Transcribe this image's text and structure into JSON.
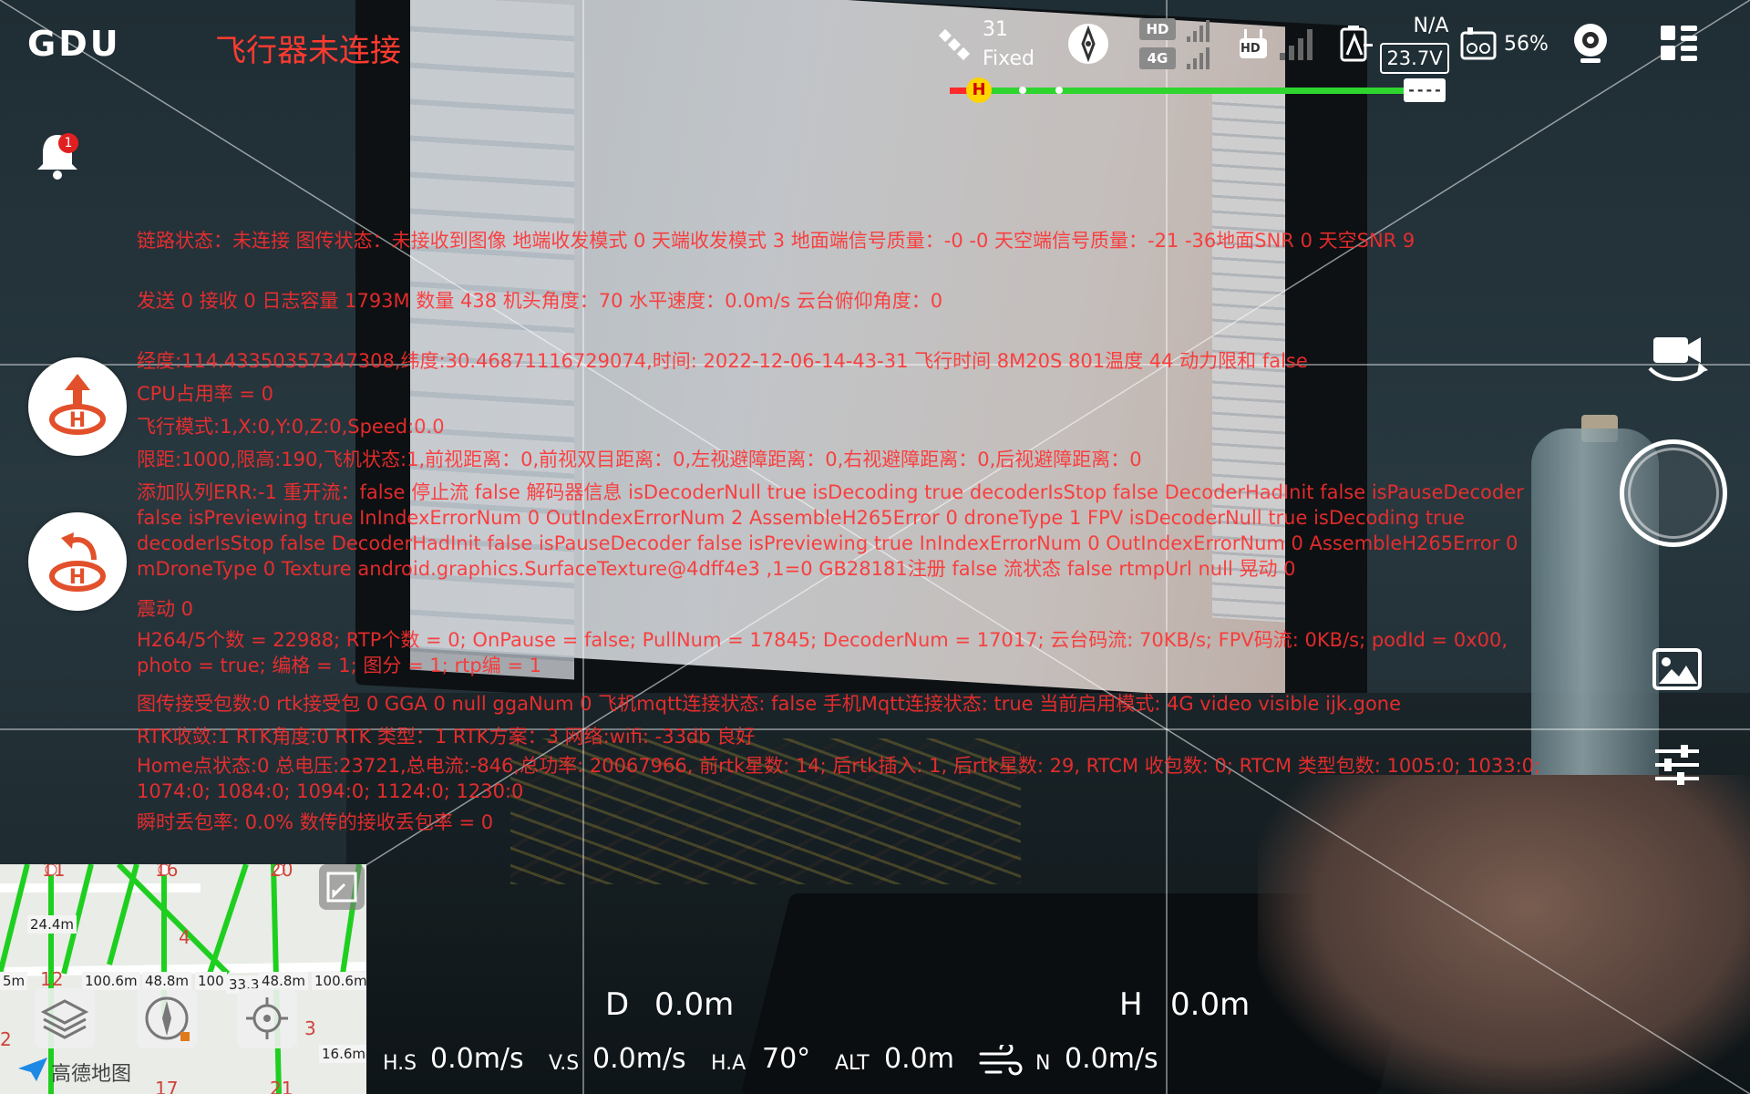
{
  "app": {
    "logo": "GDU",
    "connection_status": "飞行器未连接",
    "notification_count": "1"
  },
  "status_bar": {
    "satellite_count": "31",
    "satellite_fix": "Fixed",
    "hd_badge": "HD",
    "net_badge": "4G",
    "rc_hd_badge": "HD",
    "rc_status": "N/A",
    "voltage": "23.7V",
    "battery_percent": "56%",
    "home_marker": "H",
    "limit_box": "----"
  },
  "debug_lines": [
    " 链路状态：未连接  图传状态：未接收到图像 地端收发模式 0 天端收发模式 3  地面端信号质量：-0 -0  天空端信号质量：-21 -36地面SNR 0 天空SNR 9",
    "       发送 0 接收 0    日志容量 1793M 数量 438 机头角度：70 水平速度：0.0m/s 云台俯仰角度：0",
    "经度:114.43350357347308,纬度:30.46871116729074,时间: 2022-12-06-14-43-31  飞行时间 8M20S  801温度 44 动力限和 false",
    " CPU占用率 = 0",
    "飞行模式:1,X:0,Y:0,Z:0,Speed:0.0",
    "限距:1000,限高:190,飞机状态:1,前视距离：0,前视双目距离：0,左视避障距离：0,右视避障距离：0,后视避障距离：0",
    "添加队列ERR:-1 重开流：false 停止流 false 解码器信息  isDecoderNull true isDecoding true decoderIsStop false DecoderHadInit false isPauseDecoder false isPreviewing true InIndexErrorNum 0 OutIndexErrorNum 2 AssembleH265Error 0 droneType 1 FPV isDecoderNull true isDecoding true decoderIsStop false DecoderHadInit false isPauseDecoder false isPreviewing true InIndexErrorNum 0 OutIndexErrorNum 0 AssembleH265Error 0 mDroneType 0 Texture android.graphics.SurfaceTexture@4dff4e3 ,1=0 GB28181注册 false 流状态 false rtmpUrl null 晃动 0",
    "震动 0",
    " H264/5个数 = 22988; RTP个数 = 0; OnPause = false; PullNum = 17845; DecoderNum = 17017; 云台码流: 70KB/s; FPV码流: 0KB/s; podId = 0x00, photo = true; 编格 = 1; 图分 = 1; rtp编 = 1",
    "图传接受包数:0  rtk接受包 0 GGA 0 null   ggaNum  0    飞机mqtt连接状态: false 手机Mqtt连接状态: true 当前启用模式: 4G  video  visible ijk.gone",
    "RTK收敛:1 RTK角度:0 RTK 类型：1  RTK方案：3  网络:wifi: -33db 良好",
    "Home点状态:0  总电压:23721,总电流:-846,总功率: 20067966, 前rtk星数: 14; 后rtk插入: 1, 后rtk星数: 29, RTCM 收包数: 0; RTCM 类型包数: 1005:0; 1033:0; 1074:0; 1084:0; 1094:0; 1124:0; 1230:0",
    "瞬时丢包率: 0.0% 数传的接收丢包率 = 0"
  ],
  "telemetry": {
    "d_label": "D",
    "d_value": "0.0m",
    "h_label": "H",
    "h_value": "0.0m",
    "hs_label": "H.S",
    "hs_value": "0.0m/s",
    "vs_label": "V.S",
    "vs_value": "0.0m/s",
    "ha_label": "H.A",
    "ha_value": "70°",
    "alt_label": "ALT",
    "alt_value": "0.0m",
    "wind_dir": "N",
    "wind_value": "0.0m/s"
  },
  "map": {
    "credit": "高德地图",
    "distances": [
      "24.4m",
      "100.6m",
      "48.8m",
      "100",
      "33.3",
      "48.8m",
      "100.6m",
      "16.6m",
      "5m"
    ],
    "numbers": [
      "11",
      "16",
      "20",
      "4",
      "12",
      "3",
      "2",
      "17",
      "21"
    ]
  },
  "colors": {
    "connection_red": "#ff3b30",
    "debug_red": "#ff2e2e",
    "progress_green": "#2fd52f",
    "home_yellow": "#ffd400",
    "map_route_green": "#1fcf1f"
  },
  "icons": [
    "satellite-icon",
    "compass-icon",
    "signal-bars-icon",
    "remote-controller-icon",
    "aircraft-battery-icon",
    "rc-battery-icon",
    "camera-gimbal-icon",
    "menu-grid-icon",
    "bell-icon",
    "takeoff-icon",
    "return-home-icon",
    "camera-switch-icon",
    "shutter-button",
    "gallery-icon",
    "settings-sliders-icon",
    "layers-icon",
    "map-compass-icon",
    "locate-icon",
    "expand-map-icon",
    "wind-icon"
  ]
}
